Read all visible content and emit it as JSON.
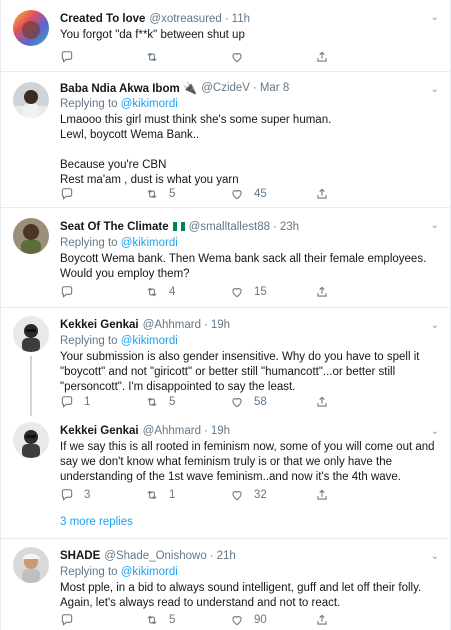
{
  "tweets": [
    {
      "name": "Created To love",
      "handle": "@xotreasured",
      "time": "11h",
      "text": [
        "You forgot \"da f**k\" between shut up"
      ],
      "replying_prefix": "",
      "replying_to": "",
      "replies": "",
      "retweets": "",
      "likes": ""
    },
    {
      "name": "Baba Ndia Akwa Ibom 🔌",
      "handle": "@CzideV",
      "time": "Mar 8",
      "replying_prefix": "Replying to",
      "replying_to": "@kikimordi",
      "text": [
        "Lmaooo this girl must think she's some super human.",
        "Lewl, boycott Wema Bank..",
        "",
        "Because you're CBN",
        "Rest ma'am , dust is what you yarn"
      ],
      "replies": "",
      "retweets": "5",
      "likes": "45"
    },
    {
      "name": "Seat Of The Climate",
      "handle": "@smalltallest88",
      "time": "23h",
      "replying_prefix": "Replying to",
      "replying_to": "@kikimordi",
      "text": [
        "Boycott Wema bank. Then Wema bank sack all their female employees.",
        "Would you employ them?"
      ],
      "replies": "",
      "retweets": "4",
      "likes": "15"
    },
    {
      "name": "Kekkei Genkai",
      "handle": "@Ahhmard",
      "time": "19h",
      "replying_prefix": "Replying to",
      "replying_to": "@kikimordi",
      "text": [
        "Your submission is also gender insensitive. Why do you have to spell it",
        "\"boycott\" and not \"giricott\" or better still \"humancott\"...or better still",
        "\"personcott\". I'm disappointed to say the least."
      ],
      "replies": "1",
      "retweets": "5",
      "likes": "58"
    },
    {
      "name": "Kekkei Genkai",
      "handle": "@Ahhmard",
      "time": "19h",
      "replying_prefix": "",
      "replying_to": "",
      "text": [
        "If we say this is all rooted in feminism now, some of you will come out and",
        "say we don't know what feminism truly is or that we only have the",
        "understanding of the 1st wave feminism..and now it's the 4th wave."
      ],
      "replies": "3",
      "retweets": "1",
      "likes": "32"
    },
    {
      "name": "SHADE",
      "handle": "@Shade_Onishowo",
      "time": "21h",
      "replying_prefix": "Replying to",
      "replying_to": "@kikimordi",
      "text": [
        "Most pple, in a bid to always sound intelligent, guff and let off their folly.",
        "Again, let's always read to understand and not to react."
      ],
      "replies": "",
      "retweets": "5",
      "likes": "90"
    }
  ],
  "more_replies": "3 more replies",
  "colors": {
    "accent": "#1da1f2",
    "muted": "#657786",
    "border": "#e6ecf0"
  },
  "icons": {
    "reply": "reply-icon",
    "retweet": "retweet-icon",
    "like": "heart-icon",
    "share": "share-icon",
    "caret": "chevron-down-icon"
  }
}
